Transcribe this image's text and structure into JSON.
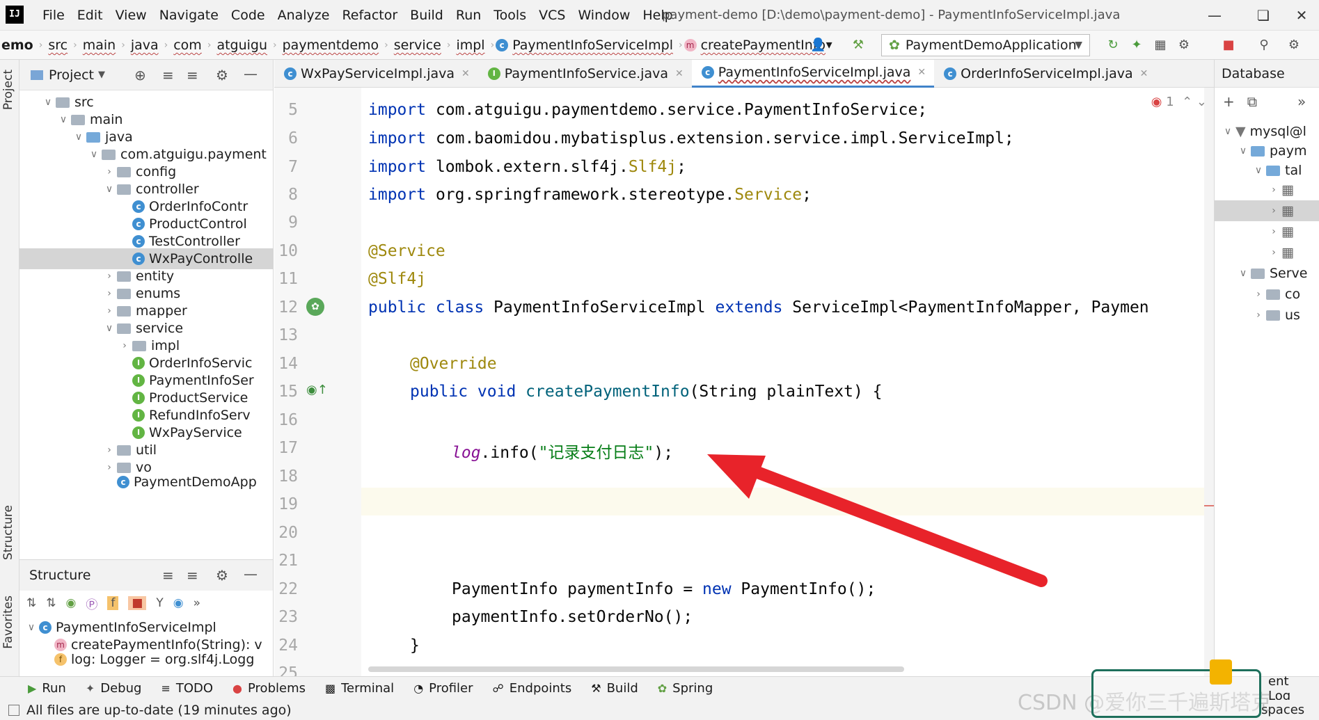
{
  "menubar": {
    "items": [
      "File",
      "Edit",
      "View",
      "Navigate",
      "Code",
      "Analyze",
      "Refactor",
      "Build",
      "Run",
      "Tools",
      "VCS",
      "Window",
      "Help"
    ],
    "window_title": "payment-demo [D:\\demo\\payment-demo] - PaymentInfoServiceImpl.java"
  },
  "breadcrumb": [
    "emo",
    "src",
    "main",
    "java",
    "com",
    "atguigu",
    "paymentdemo",
    "service",
    "impl",
    "PaymentInfoServiceImpl",
    "createPaymentInfo"
  ],
  "run_config": "PaymentDemoApplication",
  "project": {
    "title": "Project",
    "tree": [
      "src",
      "main",
      "java",
      "com.atguigu.payment",
      "config",
      "controller",
      "OrderInfoContr",
      "ProductControl",
      "TestController",
      "WxPayControlle",
      "entity",
      "enums",
      "mapper",
      "service",
      "impl",
      "OrderInfoServic",
      "PaymentInfoSer",
      "ProductService",
      "RefundInfoServ",
      "WxPayService",
      "util",
      "vo",
      "PaymentDemoApp"
    ]
  },
  "structure": {
    "title": "Structure",
    "items": [
      "PaymentInfoServiceImpl",
      "createPaymentInfo(String): v",
      "log: Logger = org.slf4j.Logg"
    ]
  },
  "tabs": [
    "WxPayServiceImpl.java",
    "PaymentInfoService.java",
    "PaymentInfoServiceImpl.java",
    "OrderInfoServiceImpl.java"
  ],
  "editor": {
    "line_numbers": [
      "5",
      "6",
      "7",
      "8",
      "9",
      "10",
      "11",
      "12",
      "13",
      "14",
      "15",
      "16",
      "17",
      "18",
      "19",
      "20",
      "21",
      "22",
      "23",
      "24",
      "25"
    ],
    "lines": {
      "l5_kw": "import",
      "l5": " com.atguigu.paymentdemo.service.PaymentInfoService;",
      "l6_kw": "import",
      "l6": " com.baomidou.mybatisplus.extension.service.impl.ServiceImpl;",
      "l7_kw": "import",
      "l7a": " lombok.extern.slf4j.",
      "l7b": "Slf4j",
      "l7c": ";",
      "l8_kw": "import",
      "l8a": " org.springframework.stereotype.",
      "l8b": "Service",
      "l8c": ";",
      "l10": "@Service",
      "l11": "@Slf4j",
      "l12_kw1": "public class",
      "l12a": " PaymentInfoServiceImpl ",
      "l12_kw2": "extends",
      "l12b": " ServiceImpl<PaymentInfoMapper, Paymen",
      "l14": "@Override",
      "l15_kw": "public void",
      "l15_fn": " createPaymentInfo",
      "l15b": "(String plainText) {",
      "l17_log": "log",
      "l17a": ".info(",
      "l17_str": "\"记录支付日志\"",
      "l17b": ");",
      "l22a": "PaymentInfo paymentInfo = ",
      "l22_kw": "new",
      "l22b": " PaymentInfo();",
      "l23": "paymentInfo.setOrderNo();",
      "l24": "}"
    },
    "inspection_count": "1"
  },
  "database": {
    "title": "Database",
    "tree": [
      "mysql@l",
      "paym",
      "tal",
      "Serve",
      "co",
      "us"
    ]
  },
  "bottom_tools": [
    "Run",
    "Debug",
    "TODO",
    "Problems",
    "Terminal",
    "Profiler",
    "Endpoints",
    "Build",
    "Spring",
    "ent Log",
    "spaces"
  ],
  "status": "All files are up-to-date (19 minutes ago)",
  "watermark": "CSDN @爱你三千遍斯塔克",
  "colors": {
    "keyword": "#0033b3",
    "annotation": "#9e880d",
    "string": "#067d17",
    "arrow": "#e8232a"
  }
}
